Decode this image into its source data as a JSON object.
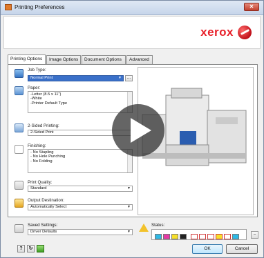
{
  "window": {
    "title": "Printing Preferences",
    "close_label": "✕"
  },
  "banner": {
    "brand": "xerox"
  },
  "tabs": [
    {
      "label": "Printing Options",
      "active": true
    },
    {
      "label": "Image Options",
      "active": false
    },
    {
      "label": "Document Options",
      "active": false
    },
    {
      "label": "Advanced",
      "active": false
    }
  ],
  "job_type": {
    "label": "Job Type:",
    "value": "Normal Print",
    "more_label": "..."
  },
  "paper": {
    "label": "Paper:",
    "lines": [
      "-Letter (8.5 x 11\")",
      "-White",
      "-Printer Default Type"
    ]
  },
  "two_sided": {
    "label": "2-Sided Printing:",
    "value": "2-Sided Print"
  },
  "finishing": {
    "label": "Finishing:",
    "lines": [
      "- No Stapling",
      "- No Hole Punching",
      "- No Folding"
    ]
  },
  "print_quality": {
    "label": "Print Quality:",
    "value": "Standard"
  },
  "output_destination": {
    "label": "Output Destination:",
    "value": "Automatically Select"
  },
  "saved_settings": {
    "label": "Saved Settings:",
    "value": "Driver Defaults"
  },
  "status": {
    "label": "Status:"
  },
  "footer": {
    "help_label": "?",
    "ok_label": "OK",
    "cancel_label": "Cancel"
  },
  "colors": {
    "brand_red": "#e8202a",
    "selection_blue": "#3a70c9",
    "title_bar": "#c6d5ea"
  },
  "icons": {
    "job_type": "job-type-icon",
    "paper": "paper-icon",
    "two_sided": "two-sided-icon",
    "finishing": "finishing-icon",
    "print_quality": "print-quality-icon",
    "output_destination": "output-destination-icon",
    "saved_settings": "saved-settings-icon",
    "status_warning": "warning-icon",
    "video_overlay": "play-icon"
  }
}
